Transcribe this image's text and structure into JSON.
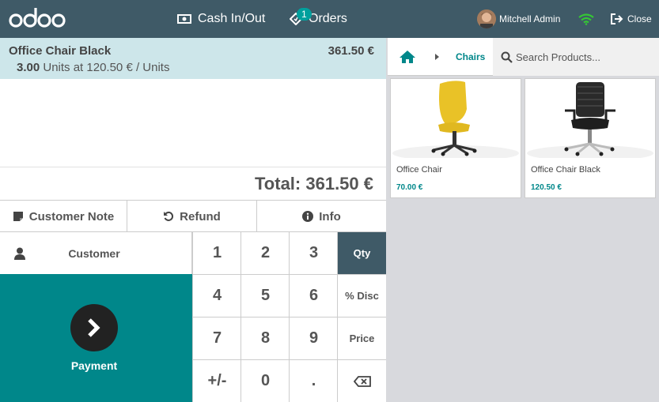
{
  "header": {
    "logo": "odoo",
    "cash_label": "Cash In/Out",
    "orders_label": "Orders",
    "orders_badge": "1",
    "user_name": "Mitchell Admin",
    "close_label": "Close",
    "icons": [
      "cash-icon",
      "orders-ticket-icon",
      "avatar",
      "wifi-icon",
      "sign-out-icon"
    ],
    "colors": {
      "bar": "#3f5a67",
      "badge": "#00a09d",
      "wifi": "#35c635"
    }
  },
  "order": {
    "line": {
      "name": "Office Chair Black",
      "price": "361.50 €",
      "qty": "3.00",
      "detail": "Units at 120.50 € / Units"
    },
    "total": "Total: 361.50 €"
  },
  "controls": {
    "customer_note": "Customer Note",
    "refund": "Refund",
    "info": "Info"
  },
  "numpad": {
    "customer": "Customer",
    "payment": "Payment",
    "keys": [
      "1",
      "2",
      "3",
      "4",
      "5",
      "6",
      "7",
      "8",
      "9",
      "+/-",
      "0",
      "."
    ],
    "modes": {
      "qty": "Qty",
      "disc": "% Disc",
      "price": "Price"
    },
    "active_mode": "Qty",
    "colors": {
      "payment": "#00878a",
      "active": "#3f5a67"
    }
  },
  "products": {
    "breadcrumb": "Chairs",
    "search_placeholder": "Search Products...",
    "items": [
      {
        "name": "Office Chair",
        "price": "70.00 €"
      },
      {
        "name": "Office Chair Black",
        "price": "120.50 €"
      }
    ]
  }
}
